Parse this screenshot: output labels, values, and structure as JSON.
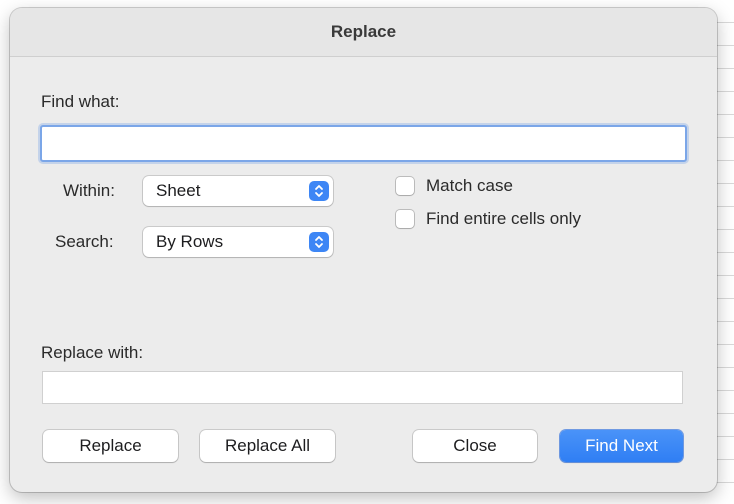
{
  "dialog": {
    "title": "Replace"
  },
  "find": {
    "label": "Find what:",
    "value": ""
  },
  "within": {
    "label": "Within:",
    "selected": "Sheet"
  },
  "search": {
    "label": "Search:",
    "selected": "By Rows"
  },
  "options": {
    "match_case": {
      "label": "Match case",
      "checked": false
    },
    "entire_cells": {
      "label": "Find entire cells only",
      "checked": false
    }
  },
  "replace": {
    "label": "Replace with:",
    "value": ""
  },
  "buttons": {
    "replace": "Replace",
    "replace_all": "Replace All",
    "close": "Close",
    "find_next": "Find Next"
  },
  "colors": {
    "accent": "#3d86f5",
    "focus_ring": "#7ba6e8",
    "dialog_bg": "#ececec"
  },
  "icons": {
    "popup_stepper": "up-down-chevron-icon"
  }
}
